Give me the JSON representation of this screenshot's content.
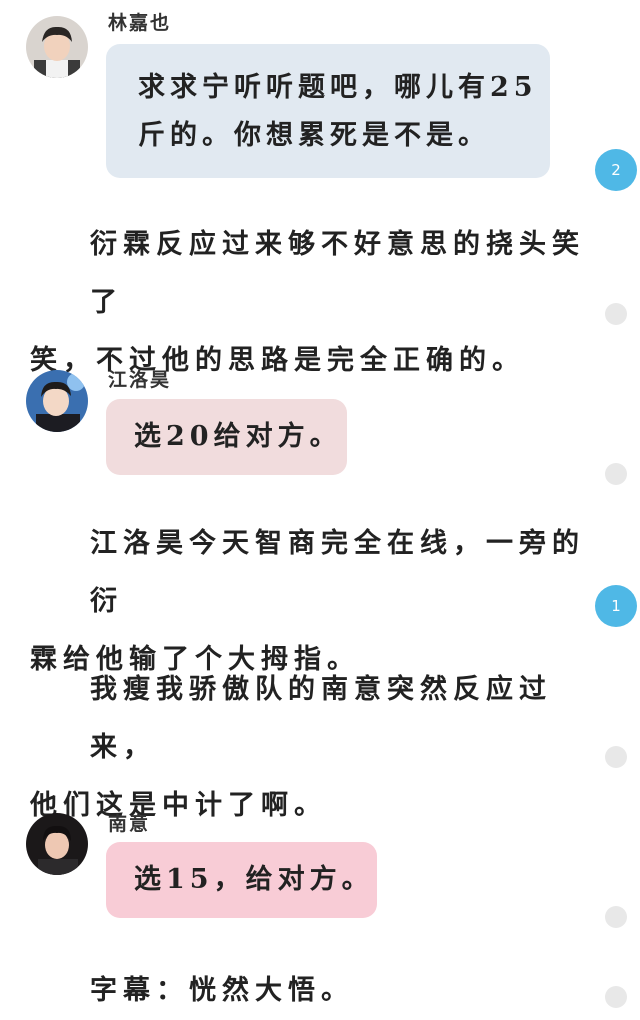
{
  "messages": [
    {
      "name": "林嘉也",
      "text_line1": "求求宁听听题吧，哪儿有25",
      "text_line2": "斤的。你想累死是不是。",
      "bubble_color": "#e1e9f1"
    },
    {
      "name": "江洛昊",
      "text": "选20给对方。",
      "bubble_color": "#f1dcdd"
    },
    {
      "name": "南意",
      "text": "选15，给对方。",
      "bubble_color": "#f8ccd6"
    }
  ],
  "paragraphs": [
    {
      "line1": "衍霖反应过来够不好意思的挠头笑了",
      "line2": "笑，不过他的思路是完全正确的。"
    },
    {
      "line1": "江洛昊今天智商完全在线，一旁的衍",
      "line2": "霖给他输了个大拇指。"
    },
    {
      "line1": "我瘦我骄傲队的南意突然反应过来，",
      "line2": "他们这是中计了啊。"
    },
    {
      "line1": "字幕：恍然大悟。"
    }
  ],
  "badges": [
    {
      "count": "2"
    },
    {
      "count": "1"
    }
  ],
  "colors": {
    "badge": "#4fb8e6",
    "dot": "#e8e8e8"
  }
}
